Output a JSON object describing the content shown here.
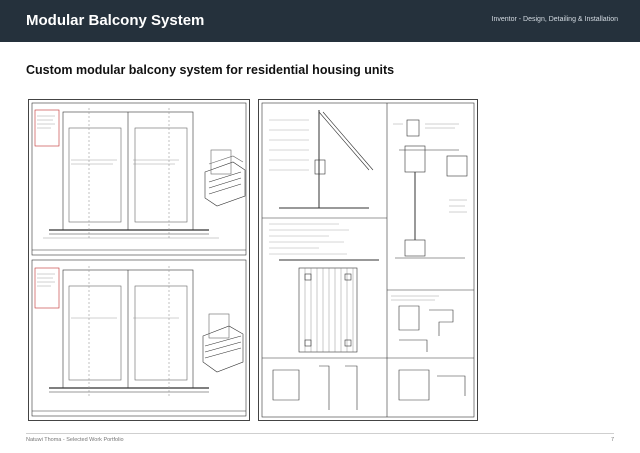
{
  "header": {
    "title": "Modular Balcony System",
    "subtitle": "Inventor - Design, Detailing & Installation",
    "background": "#25313c"
  },
  "page": {
    "heading": "Custom modular balcony system for residential housing units"
  },
  "footer": {
    "credit": "Natuwi Thoma - Selected Work Portfolio",
    "page_number": "7"
  }
}
